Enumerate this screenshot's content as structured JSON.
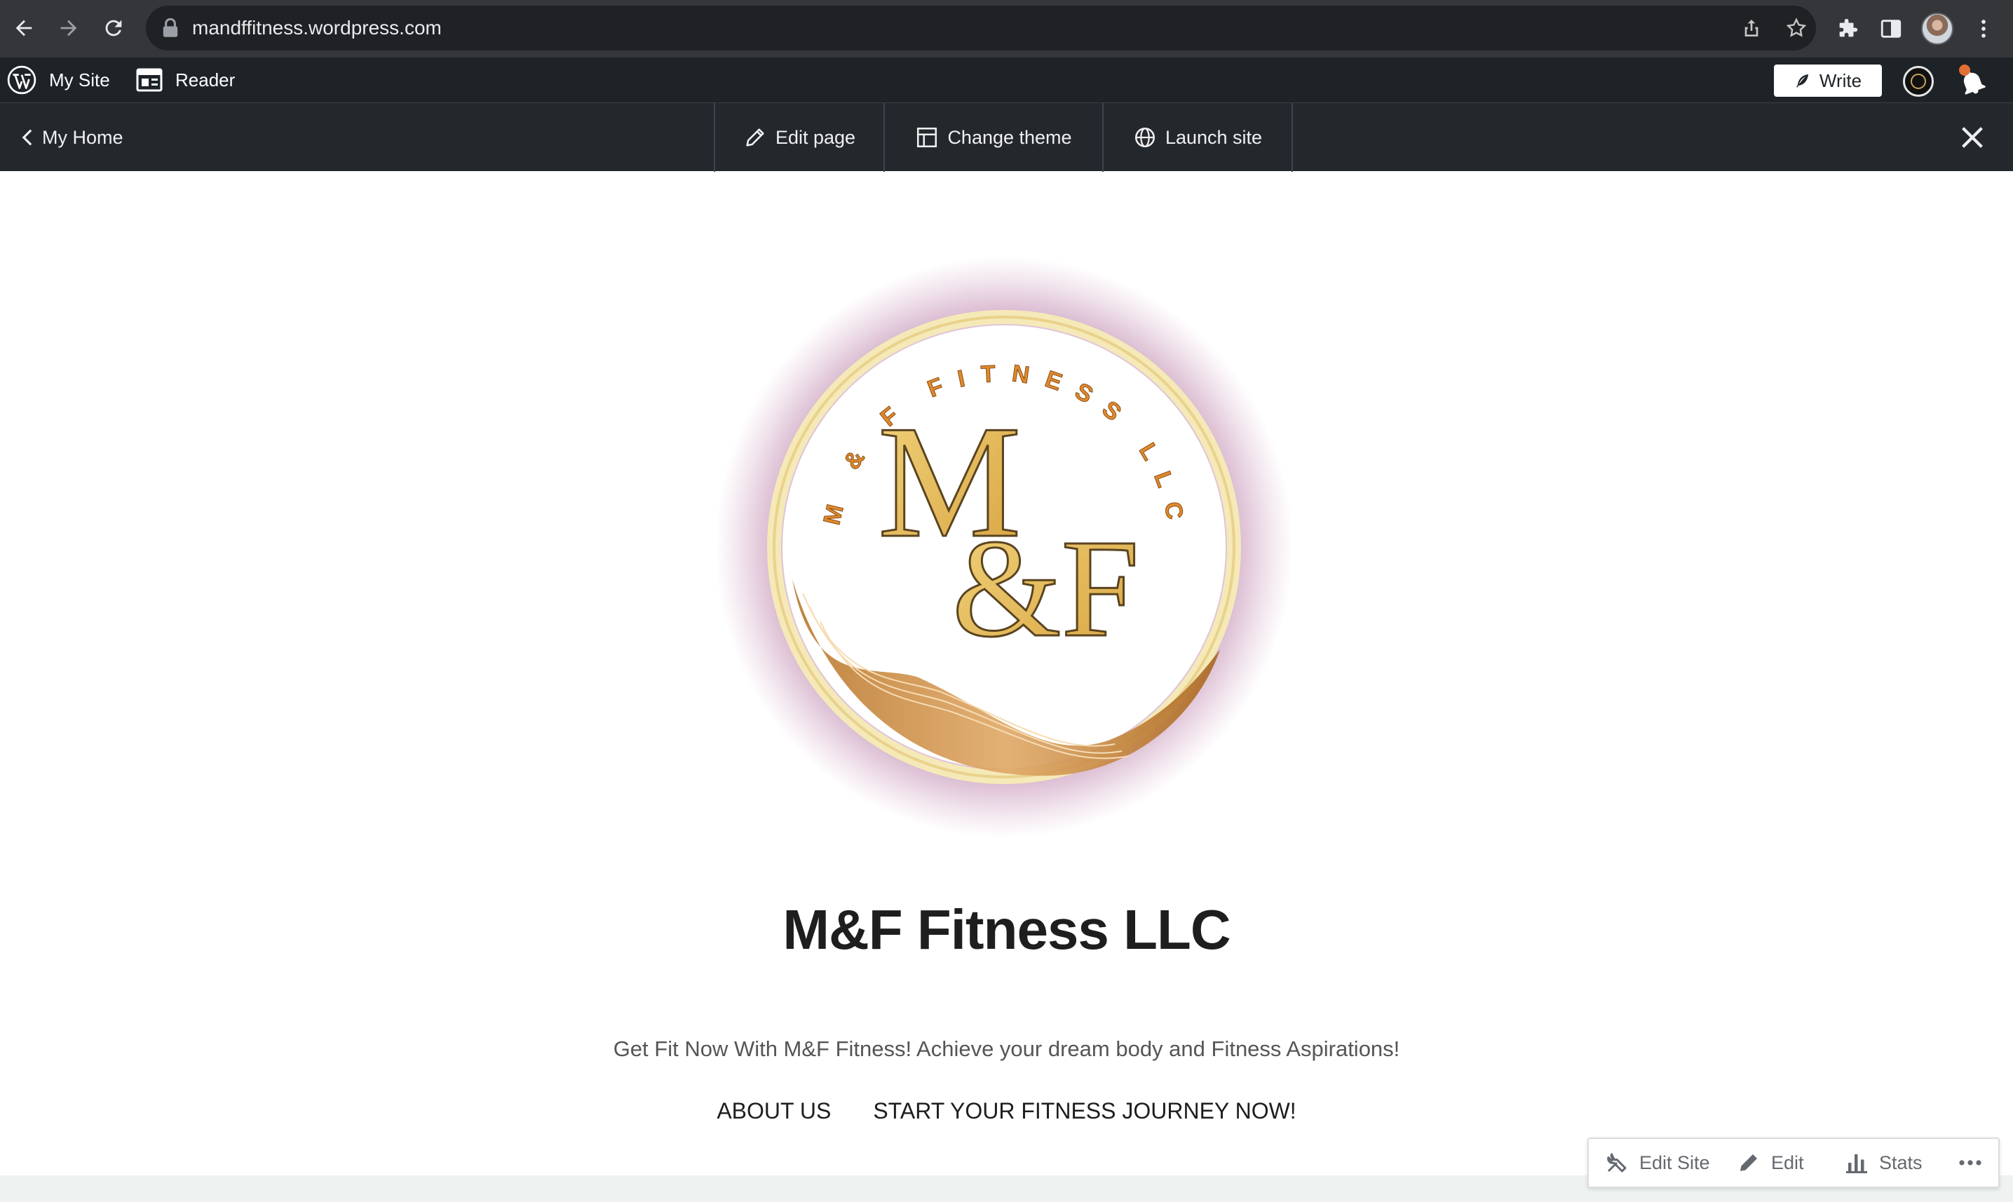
{
  "browser": {
    "url": "mandffitness.wordpress.com"
  },
  "admin_bar": {
    "my_site": "My Site",
    "reader": "Reader",
    "write": "Write"
  },
  "site_toolbar": {
    "back": "My Home",
    "edit_page": "Edit page",
    "change_theme": "Change theme",
    "launch_site": "Launch site"
  },
  "site": {
    "logo": {
      "monogram_top": "M",
      "monogram_bottom": "&F",
      "ring_text": "M & F FITNESS LLC"
    },
    "title": "M&F Fitness LLC",
    "tagline": "Get Fit Now With M&F Fitness! Achieve your dream body and Fitness Aspirations!",
    "nav": [
      "ABOUT US",
      "START YOUR FITNESS JOURNEY NOW!"
    ]
  },
  "action_bar": {
    "edit_site": "Edit Site",
    "edit": "Edit",
    "stats": "Stats"
  },
  "colors": {
    "chrome_bg": "#35363a",
    "admin_bar_bg": "#1d2327",
    "toolbar_bg": "#23282d",
    "logo_gold": "#e2b85a",
    "logo_orange": "#e08a2e"
  }
}
